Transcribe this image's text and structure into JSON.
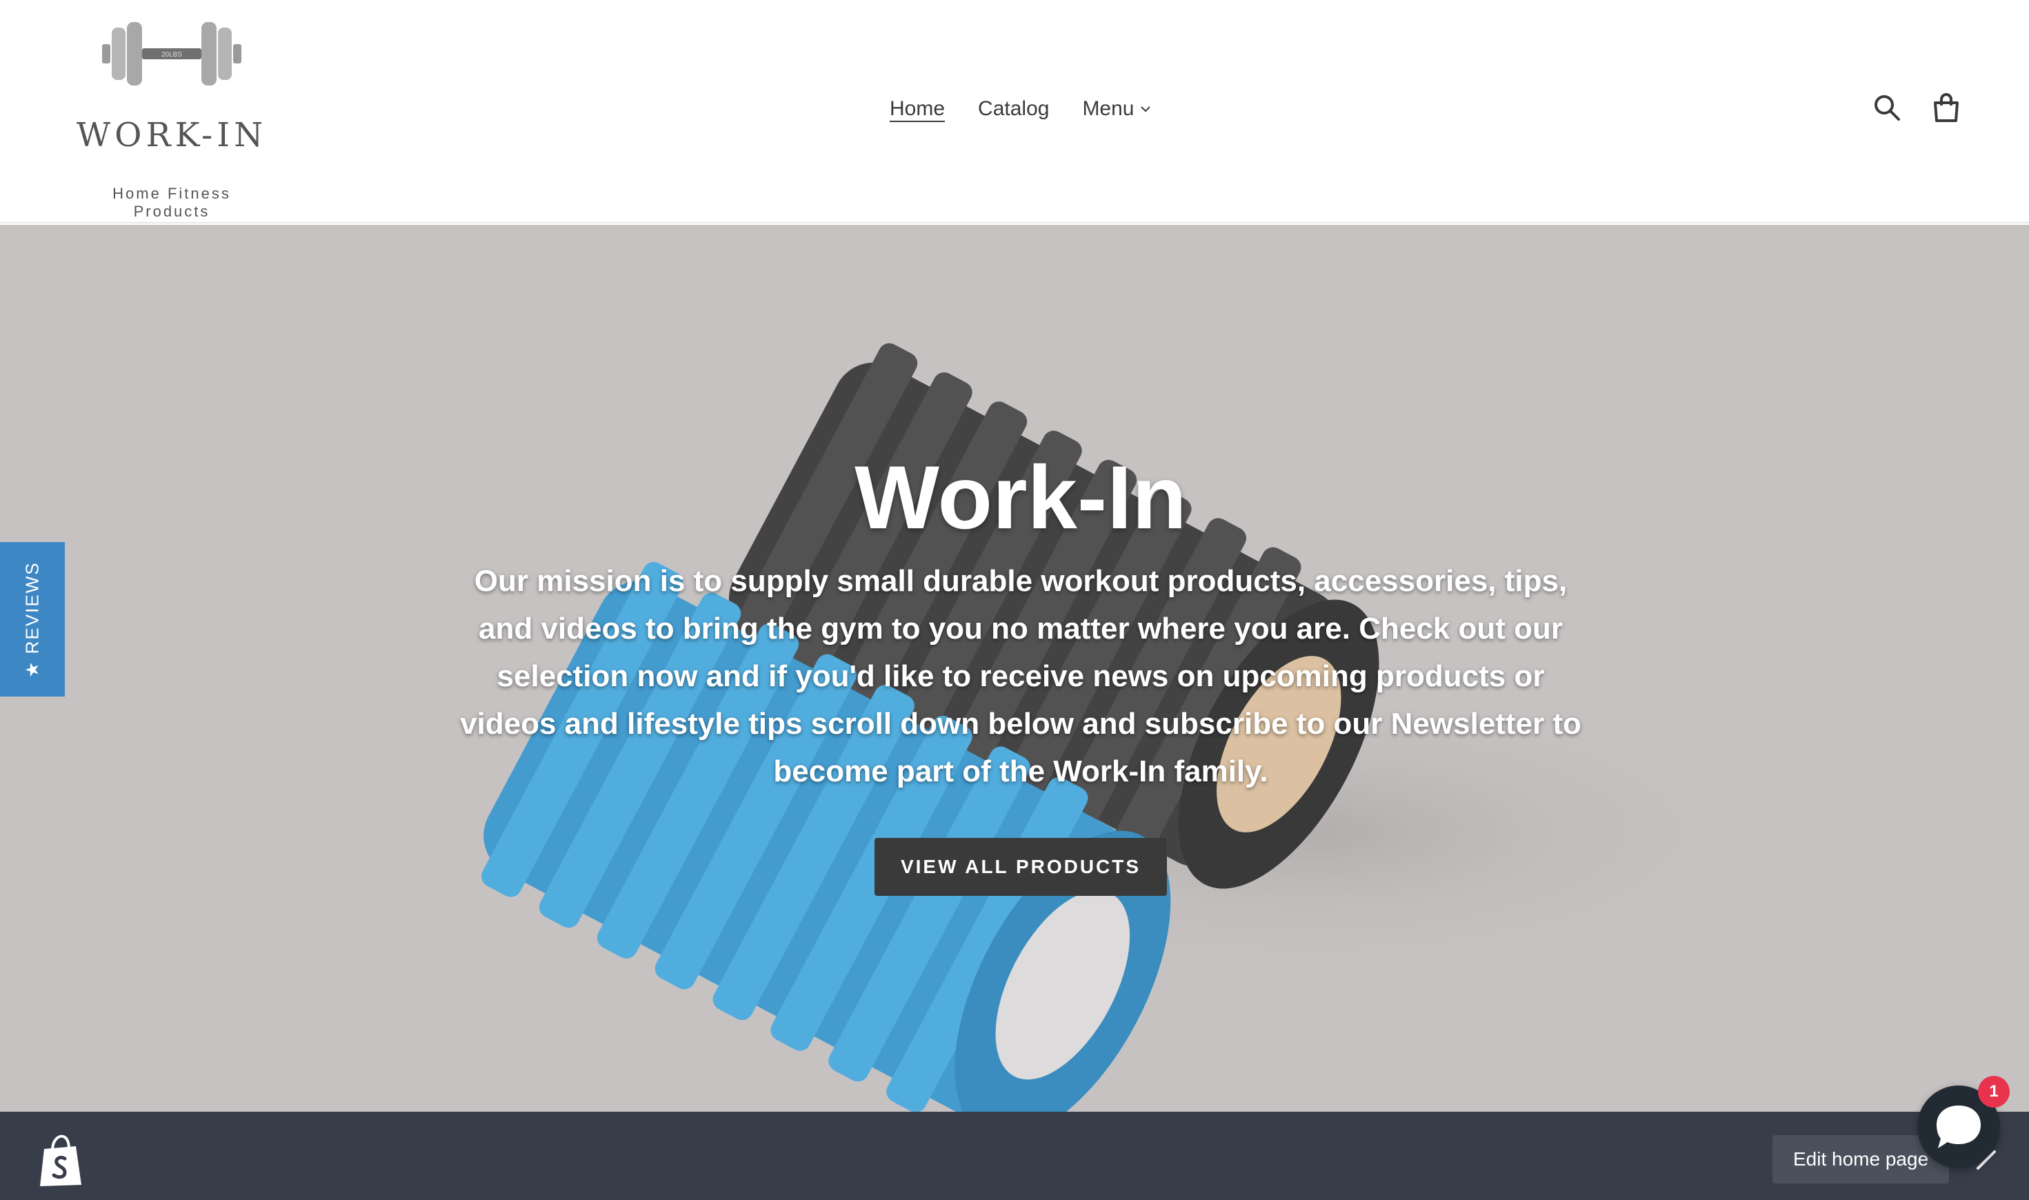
{
  "header": {
    "logo": {
      "name": "WORK-IN",
      "tagline": "Home Fitness Products",
      "dumbbell_text": "20LBS"
    },
    "nav": [
      {
        "label": "Home",
        "active": true
      },
      {
        "label": "Catalog",
        "active": false
      },
      {
        "label": "Menu",
        "active": false,
        "dropdown": true
      }
    ],
    "icons": [
      "search-icon",
      "cart-icon"
    ]
  },
  "hero": {
    "title": "Work-In",
    "text": "Our mission is to supply small durable workout products, accessories, tips, and videos to bring the gym to you no matter where you are. Check out our selection now and if you'd like to receive news on upcoming products or videos and lifestyle tips scroll down below and subscribe to our Newsletter to become part of the Work-In family.",
    "button_label": "VIEW ALL PRODUCTS"
  },
  "reviews_tab": {
    "label": "★ REVIEWS",
    "color": "#3d87c4"
  },
  "admin_bar": {
    "edit_label": "Edit home page"
  },
  "chat": {
    "badge_count": "1"
  },
  "colors": {
    "hero_bg": "#bfbaba",
    "admin_bar": "#373e4a",
    "button": "#3a3a3a",
    "badge": "#e8334d"
  }
}
